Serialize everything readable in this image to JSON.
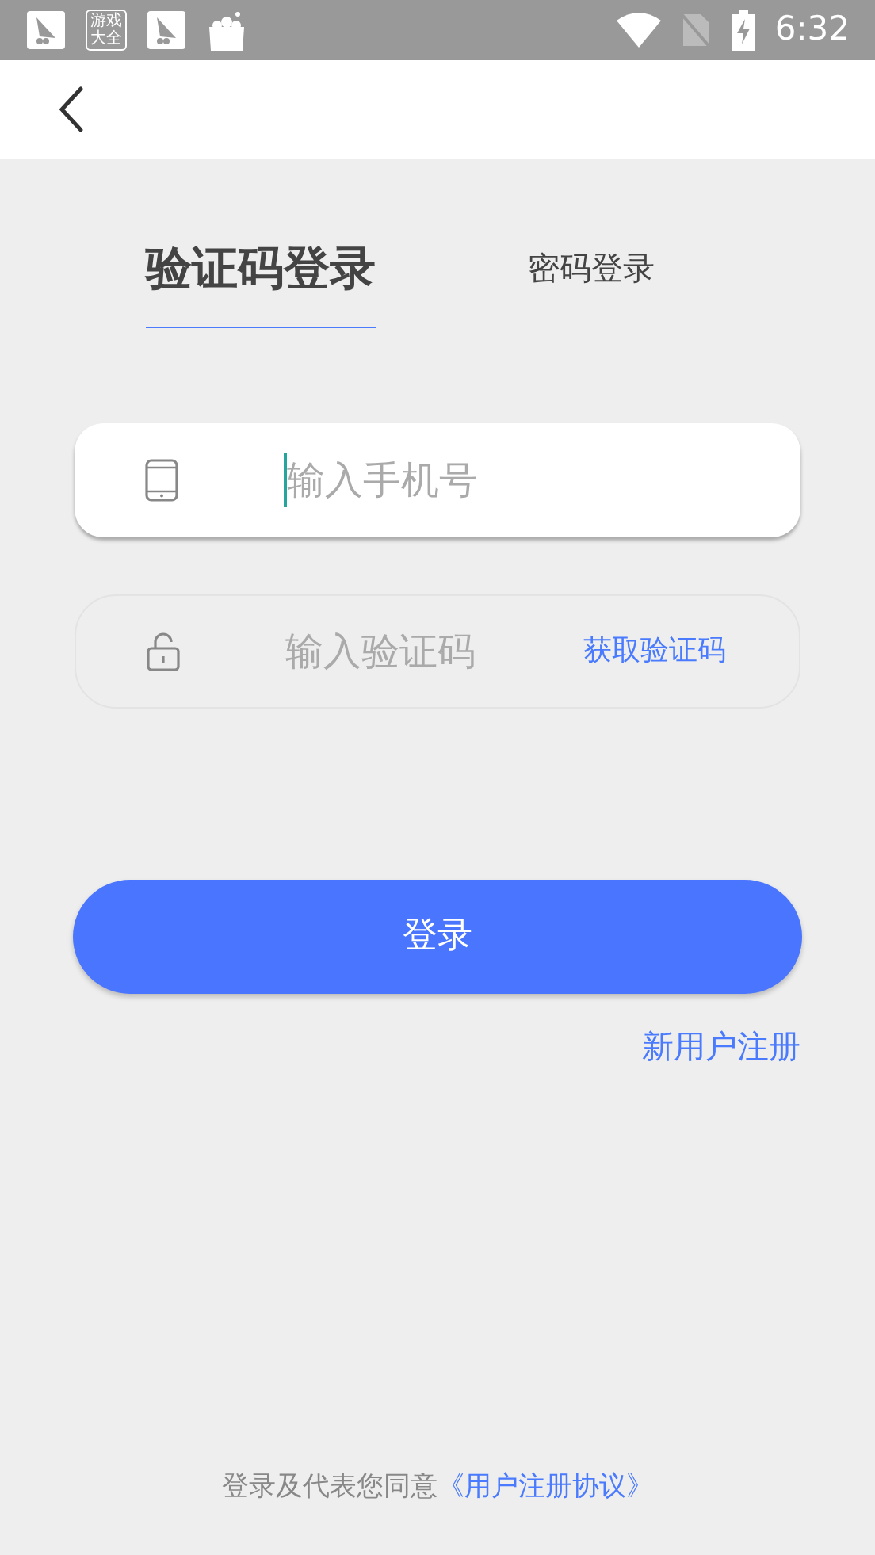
{
  "status_bar": {
    "app_icon_text": "游戏大全",
    "time": "6:32"
  },
  "tabs": [
    {
      "label": "验证码登录",
      "selected": true
    },
    {
      "label": "密码登录",
      "selected": false
    }
  ],
  "fields": [
    {
      "kind": "phone",
      "placeholder": "输入手机号",
      "focused": true
    },
    {
      "kind": "code",
      "placeholder": "输入验证码",
      "focused": false,
      "action": "获取验证码"
    }
  ],
  "login_button": "登录",
  "register_link": "新用户注册",
  "agreement": {
    "text": "登录及代表您同意",
    "link": "《用户注册协议》"
  }
}
